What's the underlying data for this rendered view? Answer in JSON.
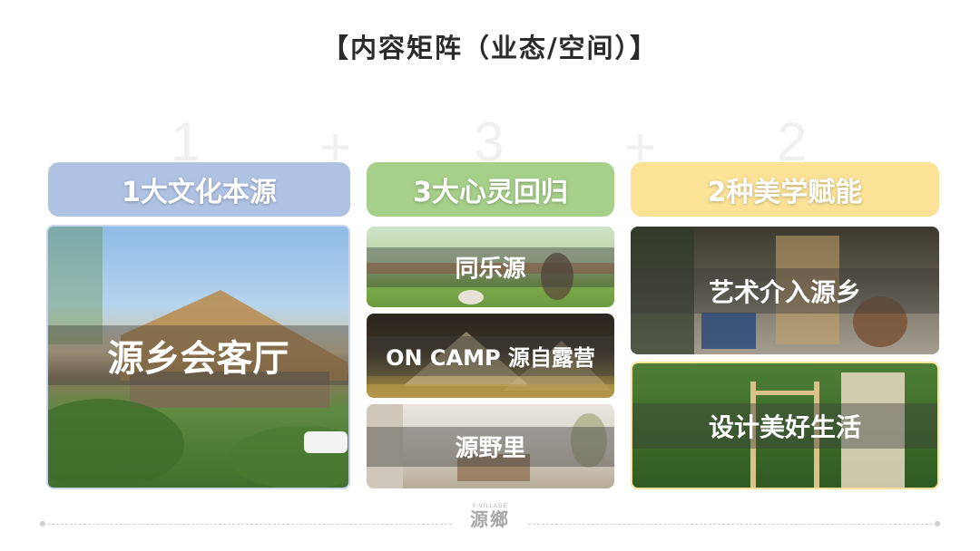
{
  "title": "【内容矩阵（业态/空间）】",
  "ghost": {
    "one": "1",
    "plus": "+",
    "three": "3",
    "two": "2"
  },
  "columns": [
    {
      "header": "1大文化本源",
      "color": "#aec2e3",
      "panels": [
        "源乡会客厅"
      ]
    },
    {
      "header": "3大心灵回归",
      "color": "#a6cf8a",
      "panels": [
        "同乐源",
        "ON CAMP 源自露营",
        "源野里"
      ]
    },
    {
      "header": "2种美学赋能",
      "color": "#fbe296",
      "panels": [
        "艺术介入源乡",
        "设计美好生活"
      ]
    }
  ],
  "footer": {
    "logo_small": "Y-VILLAGE",
    "logo_big": "源鄉"
  }
}
